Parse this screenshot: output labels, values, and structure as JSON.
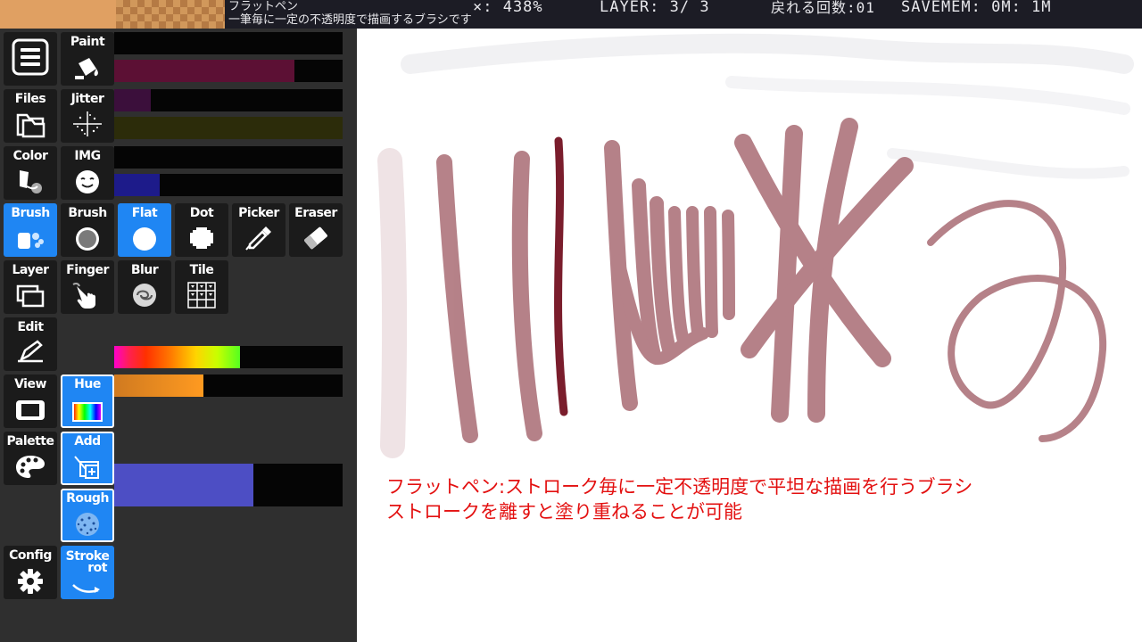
{
  "status": {
    "brush_name": "フラットペン",
    "brush_desc": "一筆毎に一定の不透明度で描画するブラシです",
    "zoom": "×: 438%",
    "layer": "LAYER: 3/ 3",
    "undo": "戻れる回数:01",
    "savemem": "SAVEMEM: 0M: 1M"
  },
  "colors": {
    "foreground": "#e0a062",
    "accent": "#1f86f3",
    "stroke": "#a6666f"
  },
  "menu_icon": "hamburger-icon",
  "tools": {
    "paint": "Paint",
    "jitter": "Jitter",
    "files": "Files",
    "color": "Color",
    "img": "IMG",
    "brush_main": "Brush",
    "brush": "Brush",
    "flat": "Flat",
    "dot": "Dot",
    "picker": "Picker",
    "eraser": "Eraser",
    "layer": "Layer",
    "finger": "Finger",
    "blur": "Blur",
    "tile": "Tile",
    "edit": "Edit",
    "view": "View",
    "palette": "Palette",
    "config": "Config",
    "hue": "Hue",
    "add": "Add",
    "rough": "Rough",
    "stroke_rot_1": "Stroke",
    "stroke_rot_2": "rot"
  },
  "sliders": {
    "size": 0.0,
    "opacity": 0.79,
    "jitter": 0.16,
    "jitter2": 1.0,
    "img": 0.0,
    "img2": 0.2,
    "hue": 0.55,
    "hue2": 0.39,
    "rough": 0.61
  },
  "caption": {
    "line1": "フラットペン:ストローク毎に一定不透明度で平坦な描画を行うブラシ",
    "line2": "ストロークを離すと塗り重ねることが可能"
  }
}
